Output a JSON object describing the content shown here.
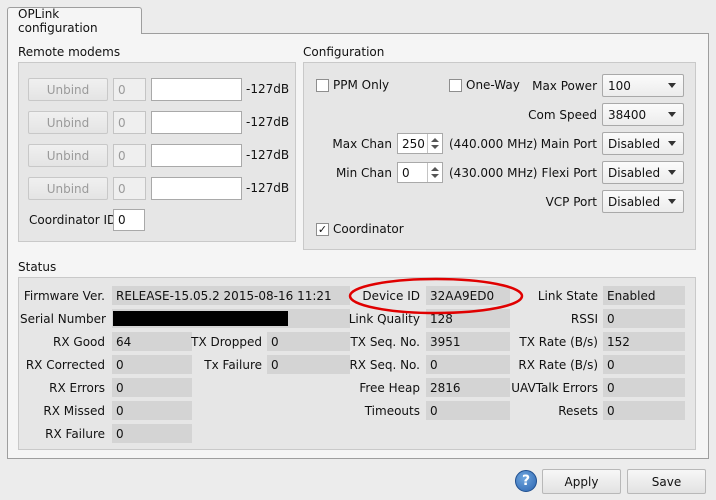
{
  "tab": {
    "label": "OPLink configuration"
  },
  "remote_modems": {
    "title": "Remote modems",
    "rows": [
      {
        "unbind_label": "Unbind",
        "index_value": "0",
        "address_value": "",
        "db": "-127dB"
      },
      {
        "unbind_label": "Unbind",
        "index_value": "0",
        "address_value": "",
        "db": "-127dB"
      },
      {
        "unbind_label": "Unbind",
        "index_value": "0",
        "address_value": "",
        "db": "-127dB"
      },
      {
        "unbind_label": "Unbind",
        "index_value": "0",
        "address_value": "",
        "db": "-127dB"
      }
    ],
    "coordinator_id_label": "Coordinator ID",
    "coordinator_id_value": "0"
  },
  "configuration": {
    "title": "Configuration",
    "ppm_only_label": "PPM Only",
    "ppm_only_checked": false,
    "one_way_label": "One-Way",
    "one_way_checked": false,
    "max_chan_label": "Max Chan",
    "max_chan_value": "250",
    "max_chan_freq": "(440.000 MHz)",
    "min_chan_label": "Min Chan",
    "min_chan_value": "0",
    "min_chan_freq": "(430.000 MHz)",
    "coordinator_label": "Coordinator",
    "coordinator_checked": true,
    "check_glyph": "✓",
    "max_power_label": "Max Power",
    "max_power_value": "100",
    "com_speed_label": "Com Speed",
    "com_speed_value": "38400",
    "main_port_label": "Main Port",
    "main_port_value": "Disabled",
    "flexi_port_label": "Flexi Port",
    "flexi_port_value": "Disabled",
    "vcp_port_label": "VCP Port",
    "vcp_port_value": "Disabled"
  },
  "status": {
    "title": "Status",
    "firmware_label": "Firmware Ver.",
    "firmware_value": "RELEASE-15.05.2 2015-08-16 11:21",
    "serial_label": "Serial Number",
    "serial_value": "",
    "device_id_label": "Device ID",
    "device_id_value": "32AA9ED0",
    "link_state_label": "Link State",
    "link_state_value": "Enabled",
    "link_quality_label": "Link Quality",
    "link_quality_value": "128",
    "rssi_label": "RSSI",
    "rssi_value": "0",
    "rx_good_label": "RX Good",
    "rx_good_value": "64",
    "tx_dropped_label": "TX Dropped",
    "tx_dropped_value": "0",
    "tx_seq_label": "TX Seq. No.",
    "tx_seq_value": "3951",
    "tx_rate_label": "TX Rate (B/s)",
    "tx_rate_value": "152",
    "rx_corrected_label": "RX Corrected",
    "rx_corrected_value": "0",
    "tx_failure_label": "Tx Failure",
    "tx_failure_value": "0",
    "rx_seq_label": "RX Seq. No.",
    "rx_seq_value": "0",
    "rx_rate_label": "RX Rate (B/s)",
    "rx_rate_value": "0",
    "rx_errors_label": "RX Errors",
    "rx_errors_value": "0",
    "free_heap_label": "Free Heap",
    "free_heap_value": "2816",
    "uavtalk_errors_label": "UAVTalk Errors",
    "uavtalk_errors_value": "0",
    "rx_missed_label": "RX Missed",
    "rx_missed_value": "0",
    "timeouts_label": "Timeouts",
    "timeouts_value": "0",
    "resets_label": "Resets",
    "resets_value": "0",
    "rx_failure_label": "RX Failure",
    "rx_failure_value": "0"
  },
  "footer": {
    "help_glyph": "?",
    "apply_label": "Apply",
    "save_label": "Save"
  },
  "annotation_color": "#e00000"
}
